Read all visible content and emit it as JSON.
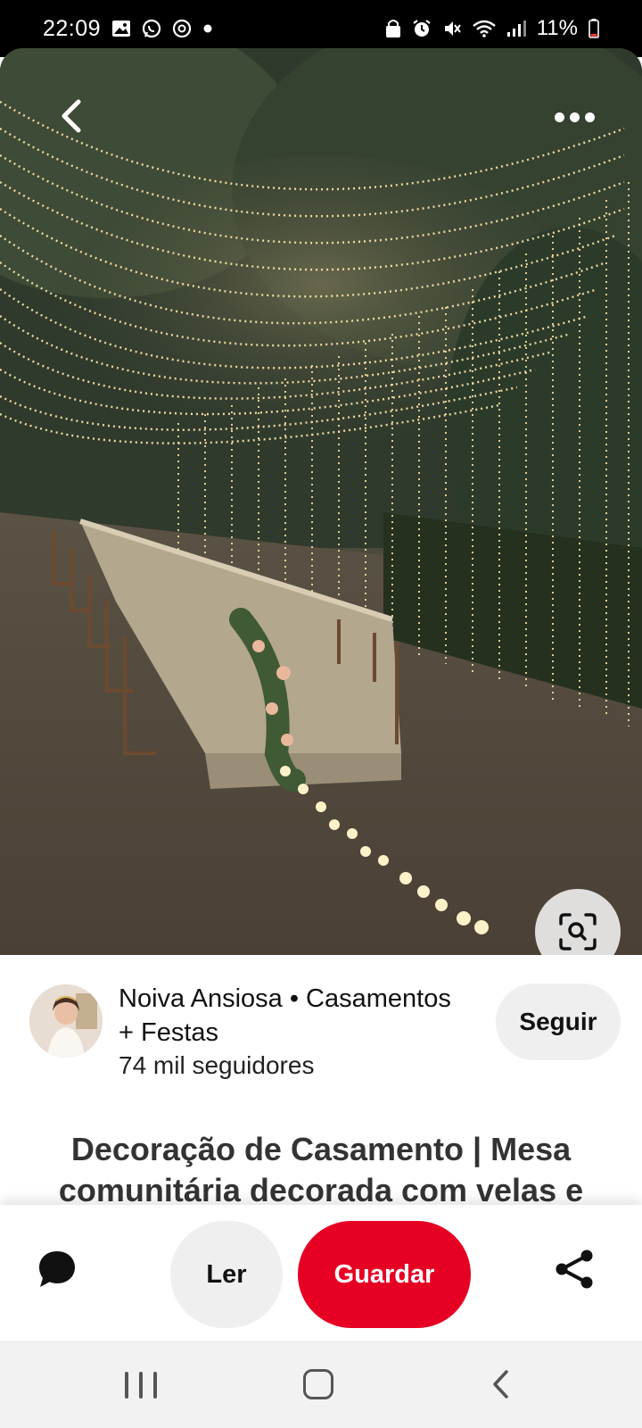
{
  "status_bar": {
    "time": "22:09",
    "left_icons": [
      "gallery-icon",
      "whatsapp-icon",
      "app-icon",
      "notification-dot-icon"
    ],
    "right_icons": [
      "lock-icon",
      "alarm-icon",
      "mute-icon",
      "wifi-icon",
      "signal-icon",
      "battery-icon"
    ],
    "battery_percent": "11%"
  },
  "pin_image": {
    "description_icons": [
      "back-arrow-icon",
      "more-options-icon",
      "visual-search-icon"
    ]
  },
  "creator": {
    "name": "Noiva Ansiosa • Casamentos + Festas",
    "followers": "74 mil seguidores",
    "follow_label": "Seguir"
  },
  "pin": {
    "title": "Decoração de Casamento | Mesa comunitária decorada com velas e"
  },
  "actions": {
    "read_label": "Ler",
    "save_label": "Guardar",
    "accent_color": "#e60023"
  },
  "nav_bar": {
    "buttons": [
      "recent-apps-icon",
      "home-icon",
      "back-icon"
    ]
  }
}
